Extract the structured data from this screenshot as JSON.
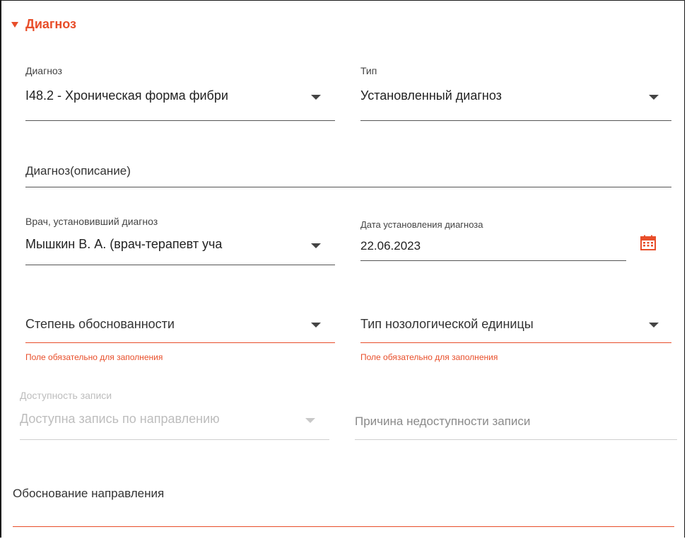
{
  "section": {
    "title": "Диагноз",
    "accent_color": "#e84e2a"
  },
  "fields": {
    "diagnosis": {
      "label": "Диагноз",
      "value": "I48.2 - Хроническая форма фибри"
    },
    "type": {
      "label": "Тип",
      "value": "Установленный диагноз"
    },
    "diagnosis_description": {
      "placeholder": "Диагноз(описание)"
    },
    "doctor": {
      "label": "Врач, установивший диагноз",
      "value": "Мышкин В. А. (врач-терапевт уча"
    },
    "date": {
      "label": "Дата установления диагноза",
      "value": "22.06.2023",
      "icon": "calendar-icon"
    },
    "validity_degree": {
      "placeholder": "Степень обоснованности",
      "error": "Поле обязательно для заполнения"
    },
    "nosology_type": {
      "placeholder": "Тип нозологической единицы",
      "error": "Поле обязательно для заполнения"
    },
    "record_availability": {
      "label": "Доступность записи",
      "value": "Доступна запись по направлению",
      "disabled": true
    },
    "unavailability_reason": {
      "placeholder": "Причина недоступности записи",
      "disabled": true
    },
    "referral_justification": {
      "placeholder": "Обоснование направления"
    }
  }
}
